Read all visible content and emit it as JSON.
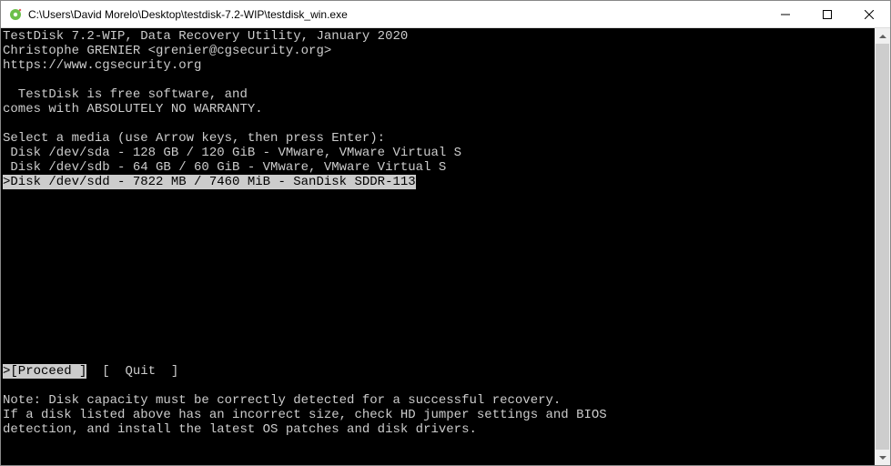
{
  "window": {
    "title": "C:\\Users\\David Morelo\\Desktop\\testdisk-7.2-WIP\\testdisk_win.exe"
  },
  "header": {
    "line1": "TestDisk 7.2-WIP, Data Recovery Utility, January 2020",
    "line2": "Christophe GRENIER <grenier@cgsecurity.org>",
    "line3": "https://www.cgsecurity.org"
  },
  "about": {
    "line1": "  TestDisk is free software, and",
    "line2": "comes with ABSOLUTELY NO WARRANTY."
  },
  "prompt": "Select a media (use Arrow keys, then press Enter):",
  "disks": [
    {
      "text": " Disk /dev/sda - 128 GB / 120 GiB - VMware, VMware Virtual S",
      "selected": false
    },
    {
      "text": " Disk /dev/sdb - 64 GB / 60 GiB - VMware, VMware Virtual S",
      "selected": false
    },
    {
      "text": ">Disk /dev/sdd - 7822 MB / 7460 MiB - SanDisk SDDR-113",
      "selected": true
    }
  ],
  "menu": {
    "proceed_prefix": ">",
    "proceed": "[Proceed ]",
    "gap": "  ",
    "quit": "[  Quit  ]"
  },
  "note": {
    "line1": "Note: Disk capacity must be correctly detected for a successful recovery.",
    "line2": "If a disk listed above has an incorrect size, check HD jumper settings and BIOS",
    "line3": "detection, and install the latest OS patches and disk drivers."
  }
}
